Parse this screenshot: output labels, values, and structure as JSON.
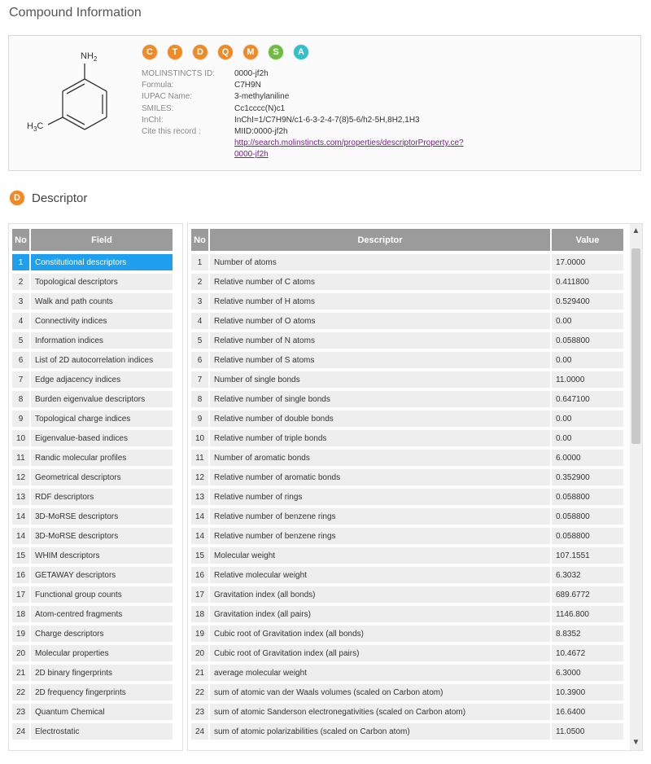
{
  "page_title": "Compound Information",
  "badges": [
    {
      "letter": "C",
      "color": "#f08a24"
    },
    {
      "letter": "T",
      "color": "#f08a24"
    },
    {
      "letter": "D",
      "color": "#f08a24"
    },
    {
      "letter": "Q",
      "color": "#f08a24"
    },
    {
      "letter": "M",
      "color": "#f08a24"
    },
    {
      "letter": "S",
      "color": "#6fbd3e"
    },
    {
      "letter": "A",
      "color": "#2fc1c9"
    }
  ],
  "molecule": {
    "nh2": "NH",
    "nh2_sub": "2",
    "ch3": "H",
    "ch3_sub": "3",
    "ch3_c": "C"
  },
  "info": {
    "id_label": "MOLINSTINCTS ID:",
    "id_val": "0000-jf2h",
    "formula_label": "Formula:",
    "formula_val": "C7H9N",
    "iupac_label": "IUPAC Name:",
    "iupac_val": "3-methylaniline",
    "smiles_label": "SMILES:",
    "smiles_val": "Cc1cccc(N)c1",
    "inchi_label": "InChI:",
    "inchi_val": "InChI=1/C7H9N/c1-6-3-2-4-7(8)5-6/h2-5H,8H2,1H3",
    "cite_label": "Cite this record :",
    "cite_val": "MIID:0000-jf2h",
    "link1": "http://search.molinstincts.com/properties/descriptorProperty.ce?",
    "link2": "0000-jf2h"
  },
  "descriptor_section": {
    "badge": "D",
    "badge_color": "#f08a24",
    "title": "Descriptor"
  },
  "left_table": {
    "headers": {
      "no": "No",
      "field": "Field"
    },
    "rows": [
      {
        "no": "1",
        "field": "Constitutional descriptors"
      },
      {
        "no": "2",
        "field": "Topological descriptors"
      },
      {
        "no": "3",
        "field": "Walk and path counts"
      },
      {
        "no": "4",
        "field": "Connectivity indices"
      },
      {
        "no": "5",
        "field": "Information indices"
      },
      {
        "no": "6",
        "field": "List of 2D autocorrelation indices"
      },
      {
        "no": "7",
        "field": "Edge adjacency indices"
      },
      {
        "no": "8",
        "field": "Burden eigenvalue descriptors"
      },
      {
        "no": "9",
        "field": "Topological charge indices"
      },
      {
        "no": "10",
        "field": "Eigenvalue-based indices"
      },
      {
        "no": "11",
        "field": "Randic molecular profiles"
      },
      {
        "no": "12",
        "field": "Geometrical descriptors"
      },
      {
        "no": "13",
        "field": "RDF descriptors"
      },
      {
        "no": "14",
        "field": "3D-MoRSE descriptors"
      },
      {
        "no": "14",
        "field": "3D-MoRSE descriptors"
      },
      {
        "no": "15",
        "field": "WHIM descriptors"
      },
      {
        "no": "16",
        "field": "GETAWAY descriptors"
      },
      {
        "no": "17",
        "field": "Functional group counts"
      },
      {
        "no": "18",
        "field": "Atom-centred fragments"
      },
      {
        "no": "19",
        "field": "Charge descriptors"
      },
      {
        "no": "20",
        "field": "Molecular properties"
      },
      {
        "no": "21",
        "field": "2D binary fingerprints"
      },
      {
        "no": "22",
        "field": "2D frequency fingerprints"
      },
      {
        "no": "23",
        "field": "Quantum Chemical"
      },
      {
        "no": "24",
        "field": "Electrostatic"
      }
    ]
  },
  "right_table": {
    "headers": {
      "no": "No",
      "descriptor": "Descriptor",
      "value": "Value"
    },
    "rows": [
      {
        "no": "1",
        "descriptor": "Number of atoms",
        "value": "17.0000"
      },
      {
        "no": "2",
        "descriptor": "Relative number of C atoms",
        "value": "0.411800"
      },
      {
        "no": "3",
        "descriptor": "Relative number of H atoms",
        "value": "0.529400"
      },
      {
        "no": "4",
        "descriptor": "Relative number of O atoms",
        "value": "0.00"
      },
      {
        "no": "5",
        "descriptor": "Relative number of N atoms",
        "value": "0.058800"
      },
      {
        "no": "6",
        "descriptor": "Relative number of S atoms",
        "value": "0.00"
      },
      {
        "no": "7",
        "descriptor": "Number of single bonds",
        "value": "11.0000"
      },
      {
        "no": "8",
        "descriptor": "Relative number of single bonds",
        "value": "0.647100"
      },
      {
        "no": "9",
        "descriptor": "Relative number of double bonds",
        "value": "0.00"
      },
      {
        "no": "10",
        "descriptor": "Relative number of triple bonds",
        "value": "0.00"
      },
      {
        "no": "11",
        "descriptor": "Number of aromatic bonds",
        "value": "6.0000"
      },
      {
        "no": "12",
        "descriptor": "Relative number of aromatic bonds",
        "value": "0.352900"
      },
      {
        "no": "13",
        "descriptor": "Relative number of rings",
        "value": "0.058800"
      },
      {
        "no": "14",
        "descriptor": "Relative number of benzene rings",
        "value": "0.058800"
      },
      {
        "no": "14",
        "descriptor": "Relative number of benzene rings",
        "value": "0.058800"
      },
      {
        "no": "15",
        "descriptor": "Molecular weight",
        "value": "107.1551"
      },
      {
        "no": "16",
        "descriptor": "Relative molecular weight",
        "value": "6.3032"
      },
      {
        "no": "17",
        "descriptor": "Gravitation index (all bonds)",
        "value": "689.6772"
      },
      {
        "no": "18",
        "descriptor": "Gravitation index (all pairs)",
        "value": "1146.800"
      },
      {
        "no": "19",
        "descriptor": "Cubic root of Gravitation index (all bonds)",
        "value": "8.8352"
      },
      {
        "no": "20",
        "descriptor": "Cubic root of Gravitation index (all pairs)",
        "value": "10.4672"
      },
      {
        "no": "21",
        "descriptor": "average molecular weight",
        "value": "6.3000"
      },
      {
        "no": "22",
        "descriptor": "sum of atomic van der Waals volumes (scaled on Carbon atom)",
        "value": "10.3900"
      },
      {
        "no": "23",
        "descriptor": "sum of atomic Sanderson electronegativities (scaled on Carbon atom)",
        "value": "16.6400"
      },
      {
        "no": "24",
        "descriptor": "sum of atomic polarizabilities (scaled on Carbon atom)",
        "value": "11.0500"
      }
    ]
  },
  "colors": {
    "selected_row": "#1ea0ef",
    "header_bg": "#9b9b9b",
    "link": "#7a1f8b"
  }
}
